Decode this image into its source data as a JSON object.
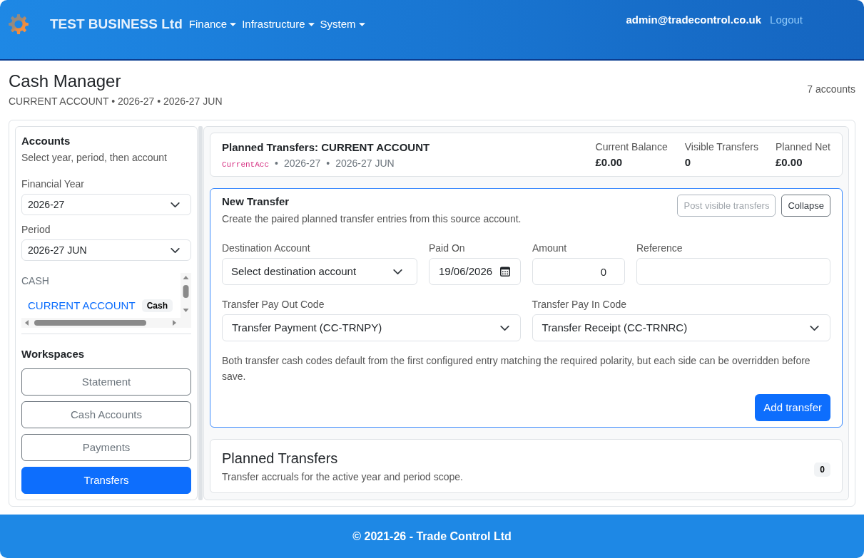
{
  "header": {
    "brand": "TEST BUSINESS Ltd",
    "nav": [
      {
        "label": "Finance"
      },
      {
        "label": "Infrastructure"
      },
      {
        "label": "System"
      }
    ],
    "user": "admin@tradecontrol.co.uk",
    "logout": "Logout"
  },
  "page": {
    "title": "Cash Manager",
    "subtitle": "CURRENT ACCOUNT • 2026-27 • 2026-27 JUN",
    "count": "7 accounts"
  },
  "sidebar": {
    "title": "Accounts",
    "hint": "Select year, period, then account",
    "fields": [
      {
        "label": "Financial Year",
        "value": "2026-27"
      },
      {
        "label": "Period",
        "value": "2026-27 JUN"
      }
    ],
    "account_group": {
      "heading": "CASH",
      "accounts": [
        {
          "name": "CURRENT ACCOUNT",
          "tag": "Cash",
          "selected": true
        }
      ]
    },
    "workspaces": {
      "title": "Workspaces",
      "items": [
        {
          "label": "Statement",
          "selected": false
        },
        {
          "label": "Cash Accounts",
          "selected": false
        },
        {
          "label": "Payments",
          "selected": false
        },
        {
          "label": "Transfers",
          "selected": true
        }
      ]
    }
  },
  "summary": {
    "title": "Planned Transfers: CURRENT ACCOUNT",
    "code": "CurrentAcc",
    "separator": "•",
    "meta": [
      "2026-27",
      "2026-27 JUN"
    ],
    "stats": [
      {
        "label": "Current Balance",
        "value": "£0.00"
      },
      {
        "label": "Visible Transfers",
        "value": "0"
      },
      {
        "label": "Planned Net",
        "value": "£0.00"
      }
    ]
  },
  "new_transfer": {
    "title": "New Transfer",
    "description": "Create the paired planned transfer entries from this source account.",
    "actions": [
      {
        "label": "Post visible transfers",
        "disabled": true
      },
      {
        "label": "Collapse",
        "disabled": false
      }
    ],
    "fields": [
      {
        "kind": "select",
        "label": "Destination Account",
        "value": "Select destination account"
      },
      {
        "kind": "date",
        "label": "Paid On",
        "value": "19/06/2026"
      },
      {
        "kind": "number",
        "label": "Amount",
        "value": "0"
      },
      {
        "kind": "text",
        "label": "Reference"
      }
    ],
    "codes": [
      {
        "label": "Transfer Pay Out Code",
        "value": "Transfer Payment (CC-TRNPY)"
      },
      {
        "label": "Transfer Pay In Code",
        "value": "Transfer Receipt (CC-TRNRC)"
      }
    ],
    "note": "Both transfer cash codes default from the first configured entry matching the required polarity, but each side can be overridden before save.",
    "submit": "Add transfer"
  },
  "planned": {
    "title": "Planned Transfers",
    "description": "Transfer accruals for the active year and period scope.",
    "count": "0"
  },
  "footer": {
    "text": "© 2021-26 - Trade Control Ltd"
  }
}
